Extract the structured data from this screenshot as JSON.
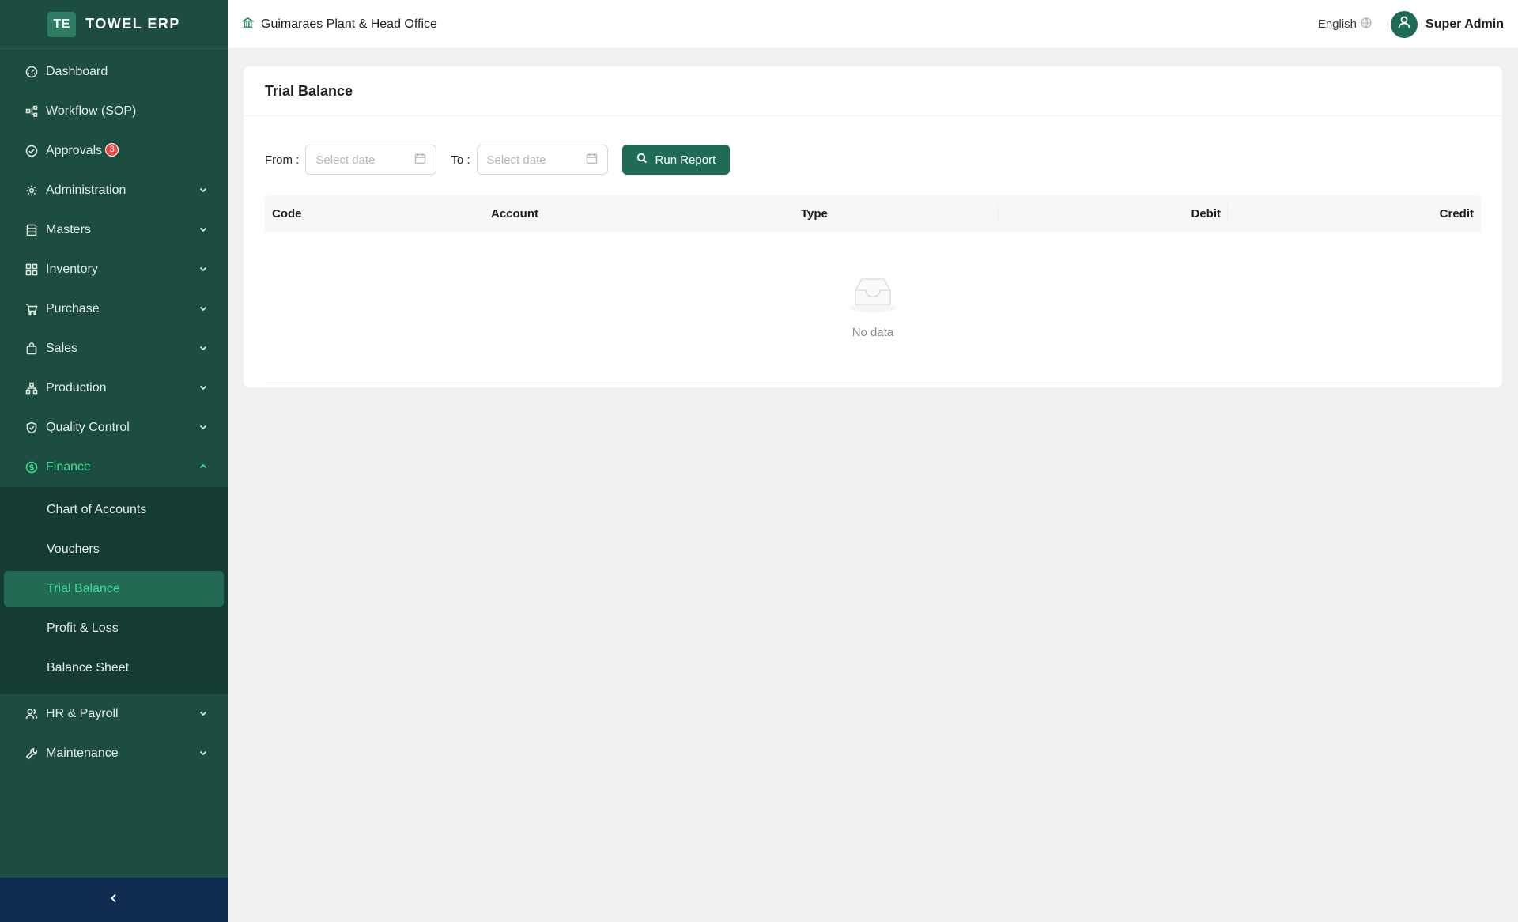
{
  "app": {
    "logo_badge": "TE",
    "logo_text": "TOWEL ERP"
  },
  "header": {
    "org_name": "Guimaraes Plant & Head Office",
    "language": "English",
    "user_name": "Super Admin"
  },
  "sidebar": {
    "items": [
      {
        "label": "Dashboard",
        "icon": "dashboard-icon"
      },
      {
        "label": "Workflow (SOP)",
        "icon": "workflow-icon"
      },
      {
        "label": "Approvals",
        "icon": "check-circle-icon",
        "badge": "3"
      },
      {
        "label": "Administration",
        "icon": "gear-icon"
      },
      {
        "label": "Masters",
        "icon": "database-icon"
      },
      {
        "label": "Inventory",
        "icon": "grid-icon"
      },
      {
        "label": "Purchase",
        "icon": "cart-icon"
      },
      {
        "label": "Sales",
        "icon": "bag-icon"
      },
      {
        "label": "Production",
        "icon": "cluster-icon"
      },
      {
        "label": "Quality Control",
        "icon": "shield-icon"
      },
      {
        "label": "Finance",
        "icon": "dollar-circle-icon"
      },
      {
        "label": "HR & Payroll",
        "icon": "team-icon"
      },
      {
        "label": "Maintenance",
        "icon": "tool-icon"
      }
    ],
    "finance_sub": [
      {
        "label": "Chart of Accounts"
      },
      {
        "label": "Vouchers"
      },
      {
        "label": "Trial Balance"
      },
      {
        "label": "Profit & Loss"
      },
      {
        "label": "Balance Sheet"
      }
    ]
  },
  "page": {
    "title": "Trial Balance",
    "from_label": "From",
    "to_label": "To",
    "from_placeholder": "Select date",
    "to_placeholder": "Select date",
    "run_button": "Run Report",
    "columns": [
      "Code",
      "Account",
      "Type",
      "Debit",
      "Credit"
    ],
    "empty_text": "No data"
  },
  "colors": {
    "sidebar_bg": "#1d4d40",
    "submenu_bg": "#153c32",
    "accent": "#3ddc97",
    "primary": "#1f6b55",
    "badge": "#e94b4b",
    "collapse_bar": "#0e2a4f"
  }
}
